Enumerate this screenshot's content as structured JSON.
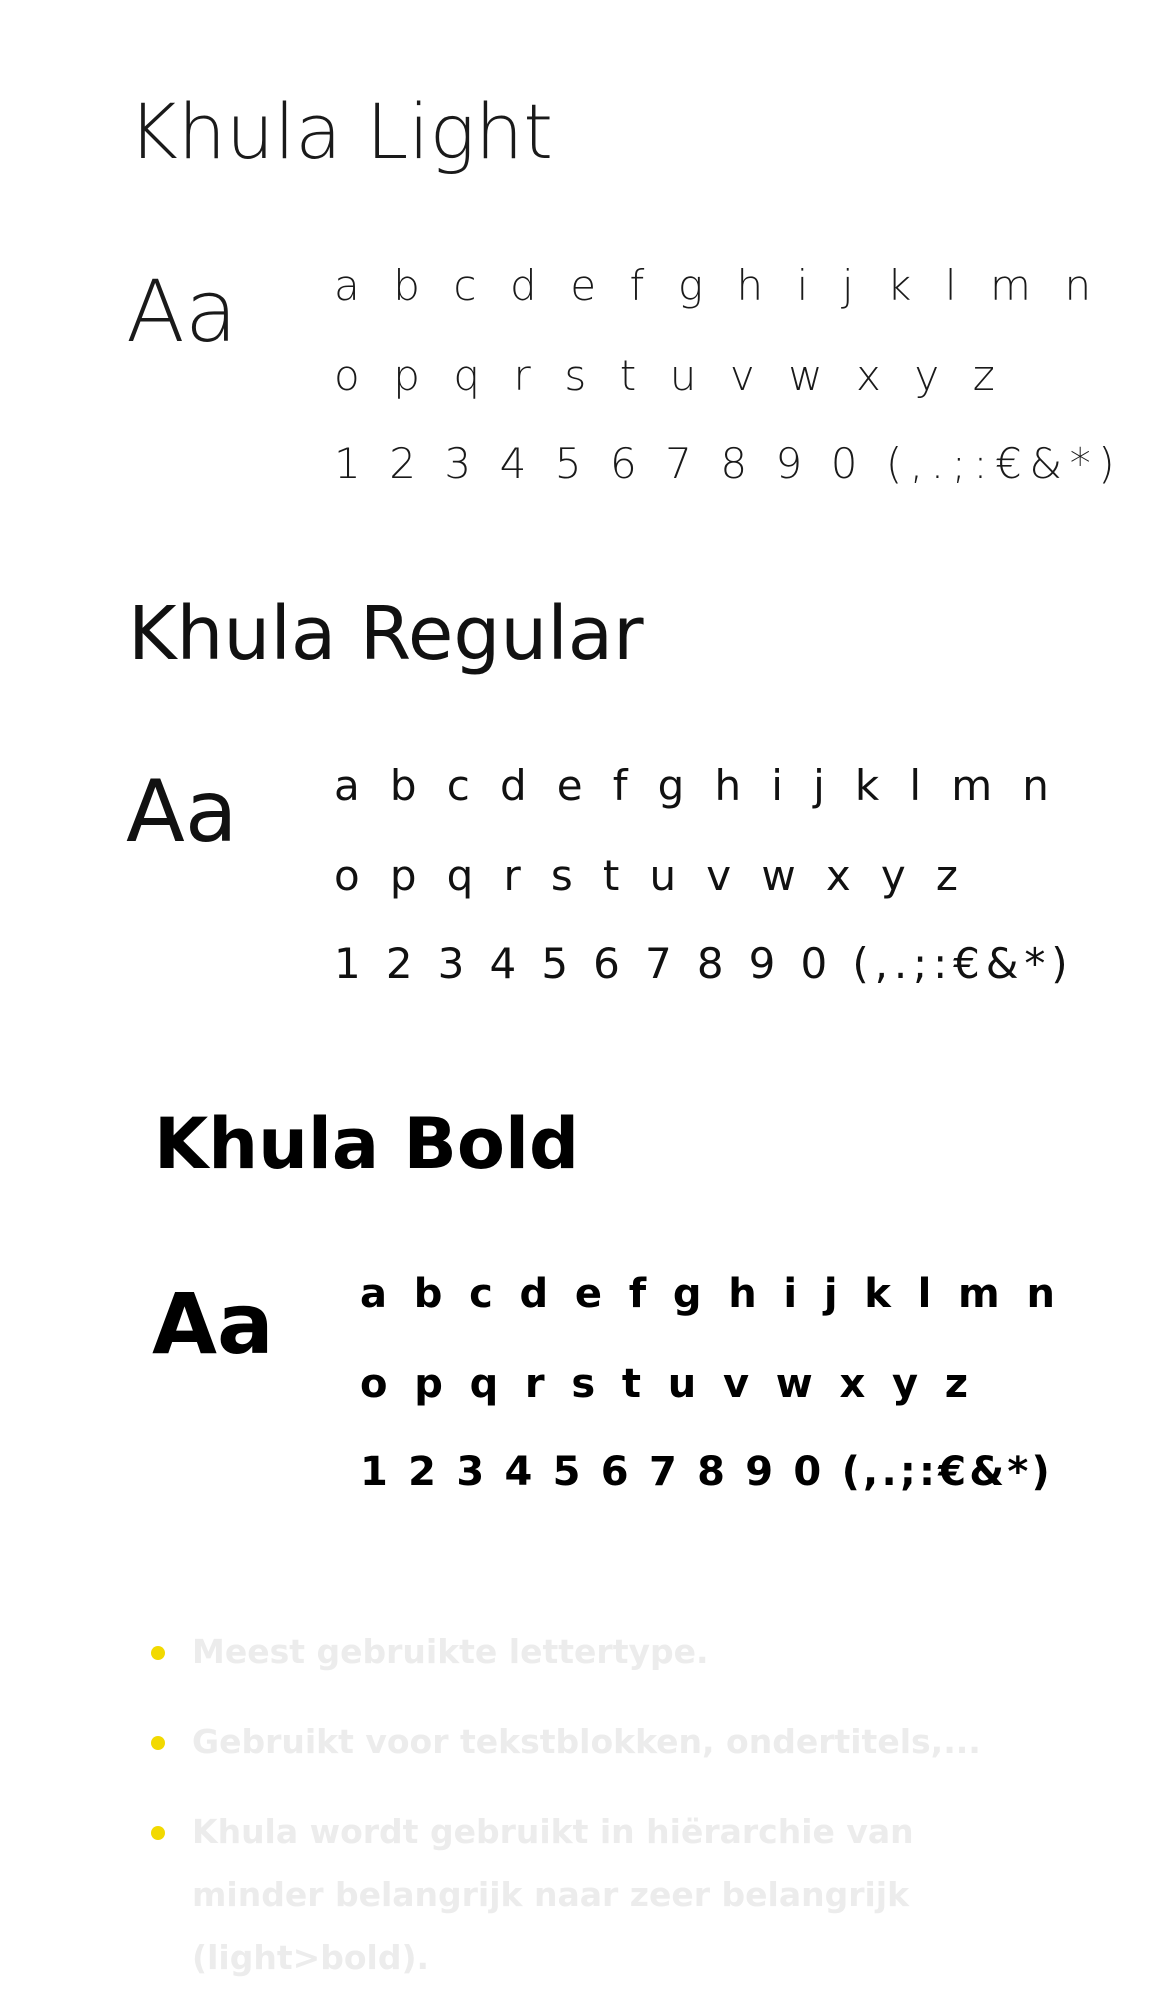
{
  "sections": [
    {
      "title": "Khula Light",
      "sample": "Aa",
      "rows": [
        "a b c d e f g h i j k l m n",
        "o p q r s t u v w x y z",
        "1 2 3 4 5 6 7 8 9 0 (,.;:€&*)"
      ]
    },
    {
      "title": "Khula Regular",
      "sample": "Aa",
      "rows": [
        "a b c d e f g h i j k l m n",
        "o p q r s t u v w x y z",
        "1 2 3 4 5 6 7 8 9 0 (,.;:€&*)"
      ]
    },
    {
      "title": "Khula Bold",
      "sample": "Aa",
      "rows": [
        "a b c d e f g h i j k l m n",
        "o p q r s t u v w x y z",
        "1 2 3 4 5 6 7 8 9 0 (,.;:€&*)"
      ]
    }
  ],
  "bullets": [
    "Meest gebruikte lettertype.",
    "Gebruikt voor tekstblokken, ondertitels,...",
    "Khula wordt gebruikt in hiërarchie van minder belangrijk naar zeer belangrijk (light>bold)."
  ],
  "colors": {
    "bullet_dot": "#f2d900",
    "bullet_text": "#ececec",
    "text": "#000000",
    "background": "#ffffff"
  }
}
